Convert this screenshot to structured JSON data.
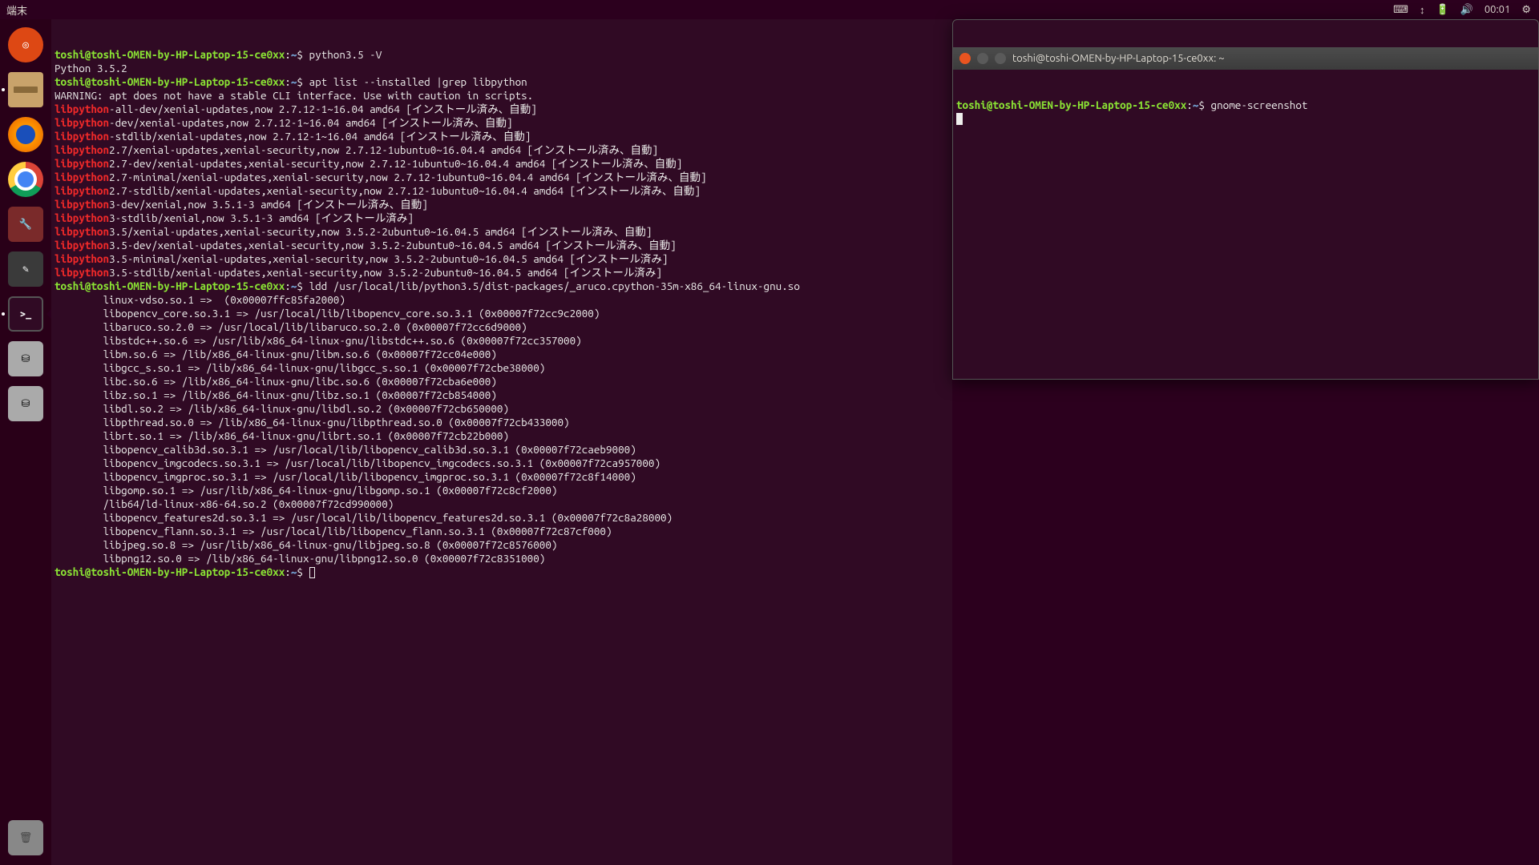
{
  "topbar": {
    "app_label": "端末",
    "clock": "00:01"
  },
  "prompt": {
    "userhost": "toshi@toshi-OMEN-by-HP-Laptop-15-ce0xx",
    "sep": ":",
    "path": "~",
    "sigil": "$ "
  },
  "term1": {
    "lines": [
      {
        "t": "prompt",
        "cmd": "python3.5 -V"
      },
      {
        "t": "out",
        "text": "Python 3.5.2"
      },
      {
        "t": "prompt",
        "cmd": "apt list --installed |grep libpython"
      },
      {
        "t": "out",
        "text": ""
      },
      {
        "t": "out",
        "text": "WARNING: apt does not have a stable CLI interface. Use with caution in scripts."
      },
      {
        "t": "out",
        "text": ""
      },
      {
        "t": "pkg",
        "pkg": "libpython",
        "rest": "-all-dev/xenial-updates,now 2.7.12-1~16.04 amd64 [インストール済み、自動]"
      },
      {
        "t": "pkg",
        "pkg": "libpython",
        "rest": "-dev/xenial-updates,now 2.7.12-1~16.04 amd64 [インストール済み、自動]"
      },
      {
        "t": "pkg",
        "pkg": "libpython",
        "rest": "-stdlib/xenial-updates,now 2.7.12-1~16.04 amd64 [インストール済み、自動]"
      },
      {
        "t": "pkg",
        "pkg": "libpython",
        "rest": "2.7/xenial-updates,xenial-security,now 2.7.12-1ubuntu0~16.04.4 amd64 [インストール済み、自動]"
      },
      {
        "t": "pkg",
        "pkg": "libpython",
        "rest": "2.7-dev/xenial-updates,xenial-security,now 2.7.12-1ubuntu0~16.04.4 amd64 [インストール済み、自動]"
      },
      {
        "t": "pkg",
        "pkg": "libpython",
        "rest": "2.7-minimal/xenial-updates,xenial-security,now 2.7.12-1ubuntu0~16.04.4 amd64 [インストール済み、自動]"
      },
      {
        "t": "pkg",
        "pkg": "libpython",
        "rest": "2.7-stdlib/xenial-updates,xenial-security,now 2.7.12-1ubuntu0~16.04.4 amd64 [インストール済み、自動]"
      },
      {
        "t": "pkg",
        "pkg": "libpython",
        "rest": "3-dev/xenial,now 3.5.1-3 amd64 [インストール済み、自動]"
      },
      {
        "t": "pkg",
        "pkg": "libpython",
        "rest": "3-stdlib/xenial,now 3.5.1-3 amd64 [インストール済み]"
      },
      {
        "t": "pkg",
        "pkg": "libpython",
        "rest": "3.5/xenial-updates,xenial-security,now 3.5.2-2ubuntu0~16.04.5 amd64 [インストール済み、自動]"
      },
      {
        "t": "pkg",
        "pkg": "libpython",
        "rest": "3.5-dev/xenial-updates,xenial-security,now 3.5.2-2ubuntu0~16.04.5 amd64 [インストール済み、自動]"
      },
      {
        "t": "pkg",
        "pkg": "libpython",
        "rest": "3.5-minimal/xenial-updates,xenial-security,now 3.5.2-2ubuntu0~16.04.5 amd64 [インストール済み]"
      },
      {
        "t": "pkg",
        "pkg": "libpython",
        "rest": "3.5-stdlib/xenial-updates,xenial-security,now 3.5.2-2ubuntu0~16.04.5 amd64 [インストール済み]"
      },
      {
        "t": "prompt",
        "cmd": "ldd /usr/local/lib/python3.5/dist-packages/_aruco.cpython-35m-x86_64-linux-gnu.so"
      },
      {
        "t": "out",
        "text": "        linux-vdso.so.1 =>  (0x00007ffc85fa2000)"
      },
      {
        "t": "out",
        "text": "        libopencv_core.so.3.1 => /usr/local/lib/libopencv_core.so.3.1 (0x00007f72cc9c2000)"
      },
      {
        "t": "out",
        "text": "        libaruco.so.2.0 => /usr/local/lib/libaruco.so.2.0 (0x00007f72cc6d9000)"
      },
      {
        "t": "out",
        "text": "        libstdc++.so.6 => /usr/lib/x86_64-linux-gnu/libstdc++.so.6 (0x00007f72cc357000)"
      },
      {
        "t": "out",
        "text": "        libm.so.6 => /lib/x86_64-linux-gnu/libm.so.6 (0x00007f72cc04e000)"
      },
      {
        "t": "out",
        "text": "        libgcc_s.so.1 => /lib/x86_64-linux-gnu/libgcc_s.so.1 (0x00007f72cbe38000)"
      },
      {
        "t": "out",
        "text": "        libc.so.6 => /lib/x86_64-linux-gnu/libc.so.6 (0x00007f72cba6e000)"
      },
      {
        "t": "out",
        "text": "        libz.so.1 => /lib/x86_64-linux-gnu/libz.so.1 (0x00007f72cb854000)"
      },
      {
        "t": "out",
        "text": "        libdl.so.2 => /lib/x86_64-linux-gnu/libdl.so.2 (0x00007f72cb650000)"
      },
      {
        "t": "out",
        "text": "        libpthread.so.0 => /lib/x86_64-linux-gnu/libpthread.so.0 (0x00007f72cb433000)"
      },
      {
        "t": "out",
        "text": "        librt.so.1 => /lib/x86_64-linux-gnu/librt.so.1 (0x00007f72cb22b000)"
      },
      {
        "t": "out",
        "text": "        libopencv_calib3d.so.3.1 => /usr/local/lib/libopencv_calib3d.so.3.1 (0x00007f72caeb9000)"
      },
      {
        "t": "out",
        "text": "        libopencv_imgcodecs.so.3.1 => /usr/local/lib/libopencv_imgcodecs.so.3.1 (0x00007f72ca957000)"
      },
      {
        "t": "out",
        "text": "        libopencv_imgproc.so.3.1 => /usr/local/lib/libopencv_imgproc.so.3.1 (0x00007f72c8f14000)"
      },
      {
        "t": "out",
        "text": "        libgomp.so.1 => /usr/lib/x86_64-linux-gnu/libgomp.so.1 (0x00007f72c8cf2000)"
      },
      {
        "t": "out",
        "text": "        /lib64/ld-linux-x86-64.so.2 (0x00007f72cd990000)"
      },
      {
        "t": "out",
        "text": "        libopencv_features2d.so.3.1 => /usr/local/lib/libopencv_features2d.so.3.1 (0x00007f72c8a28000)"
      },
      {
        "t": "out",
        "text": "        libopencv_flann.so.3.1 => /usr/local/lib/libopencv_flann.so.3.1 (0x00007f72c87cf000)"
      },
      {
        "t": "out",
        "text": "        libjpeg.so.8 => /usr/lib/x86_64-linux-gnu/libjpeg.so.8 (0x00007f72c8576000)"
      },
      {
        "t": "out",
        "text": "        libpng12.so.0 => /lib/x86_64-linux-gnu/libpng12.so.0 (0x00007f72c8351000)"
      },
      {
        "t": "prompt",
        "cmd": "",
        "cursor": "outline"
      }
    ]
  },
  "term2": {
    "title": "toshi@toshi-OMEN-by-HP-Laptop-15-ce0xx: ~",
    "lines": [
      {
        "t": "prompt",
        "cmd": "gnome-screenshot"
      },
      {
        "t": "cursor"
      }
    ]
  }
}
